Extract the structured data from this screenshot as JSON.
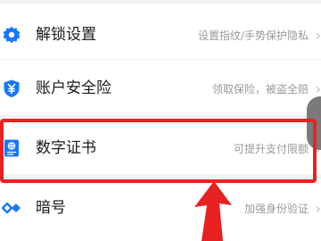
{
  "rows": [
    {
      "title": "解锁设置",
      "desc": "设置指纹/手势保护隐私",
      "icon": "gear-icon"
    },
    {
      "title": "账户安全险",
      "desc": "领取保险，被盗全赔",
      "icon": "yen-shield-icon"
    },
    {
      "title": "数字证书",
      "desc": "可提升支付限额",
      "icon": "certificate-icon"
    },
    {
      "title": "暗号",
      "desc": "加强身份验证",
      "icon": "diamond-link-icon"
    }
  ],
  "colors": {
    "icon_blue": "#1677ff",
    "highlight_red": "#e82121",
    "desc_gray": "#999999"
  }
}
